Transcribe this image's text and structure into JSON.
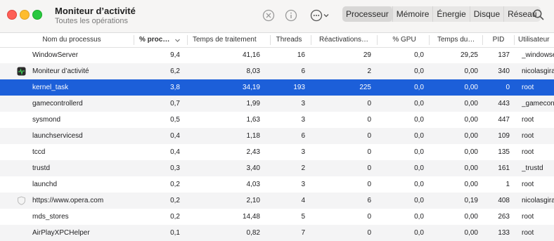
{
  "window": {
    "title": "Moniteur d’activité",
    "subtitle": "Toutes les opérations"
  },
  "toolbar": {
    "icons": [
      "stop-icon",
      "info-icon",
      "more-actions-icon",
      "search-icon"
    ],
    "tabs": [
      {
        "label": "Processeur",
        "active": true
      },
      {
        "label": "Mémoire",
        "active": false
      },
      {
        "label": "Énergie",
        "active": false
      },
      {
        "label": "Disque",
        "active": false
      },
      {
        "label": "Réseau",
        "active": false
      }
    ]
  },
  "table": {
    "columns": [
      "Nom du processus",
      "% proc…",
      "Temps de traitement",
      "Threads",
      "Réactivations…",
      "% GPU",
      "Temps du…",
      "PID",
      "Utilisateur"
    ],
    "sort_column": "% proc…",
    "rows": [
      {
        "name": "WindowServer",
        "cpu": "9,4",
        "time": "41,16",
        "threads": "16",
        "wakeups": "29",
        "gpu": "0,0",
        "gputime": "29,25",
        "pid": "137",
        "user": "_windowserver",
        "icon": ""
      },
      {
        "name": "Moniteur d’activité",
        "cpu": "6,2",
        "time": "8,03",
        "threads": "6",
        "wakeups": "2",
        "gpu": "0,0",
        "gputime": "0,00",
        "pid": "340",
        "user": "nicolasgirard",
        "icon": "activity-monitor-app-icon"
      },
      {
        "name": "kernel_task",
        "cpu": "3,8",
        "time": "34,19",
        "threads": "193",
        "wakeups": "225",
        "gpu": "0,0",
        "gputime": "0,00",
        "pid": "0",
        "user": "root",
        "icon": "",
        "selected": true
      },
      {
        "name": "gamecontrollerd",
        "cpu": "0,7",
        "time": "1,99",
        "threads": "3",
        "wakeups": "0",
        "gpu": "0,0",
        "gputime": "0,00",
        "pid": "443",
        "user": "_gamecontrollerd",
        "icon": ""
      },
      {
        "name": "sysmond",
        "cpu": "0,5",
        "time": "1,63",
        "threads": "3",
        "wakeups": "0",
        "gpu": "0,0",
        "gputime": "0,00",
        "pid": "447",
        "user": "root",
        "icon": ""
      },
      {
        "name": "launchservicesd",
        "cpu": "0,4",
        "time": "1,18",
        "threads": "6",
        "wakeups": "0",
        "gpu": "0,0",
        "gputime": "0,00",
        "pid": "109",
        "user": "root",
        "icon": ""
      },
      {
        "name": "tccd",
        "cpu": "0,4",
        "time": "2,43",
        "threads": "3",
        "wakeups": "0",
        "gpu": "0,0",
        "gputime": "0,00",
        "pid": "135",
        "user": "root",
        "icon": ""
      },
      {
        "name": "trustd",
        "cpu": "0,3",
        "time": "3,40",
        "threads": "2",
        "wakeups": "0",
        "gpu": "0,0",
        "gputime": "0,00",
        "pid": "161",
        "user": "_trustd",
        "icon": ""
      },
      {
        "name": "launchd",
        "cpu": "0,2",
        "time": "4,03",
        "threads": "3",
        "wakeups": "0",
        "gpu": "0,0",
        "gputime": "0,00",
        "pid": "1",
        "user": "root",
        "icon": ""
      },
      {
        "name": "https://www.opera.com",
        "cpu": "0,2",
        "time": "2,10",
        "threads": "4",
        "wakeups": "6",
        "gpu": "0,0",
        "gputime": "0,19",
        "pid": "408",
        "user": "nicolasgirard",
        "icon": "shield-icon"
      },
      {
        "name": "mds_stores",
        "cpu": "0,2",
        "time": "14,48",
        "threads": "5",
        "wakeups": "0",
        "gpu": "0,0",
        "gputime": "0,00",
        "pid": "263",
        "user": "root",
        "icon": ""
      },
      {
        "name": "AirPlayXPCHelper",
        "cpu": "0,1",
        "time": "0,82",
        "threads": "7",
        "wakeups": "0",
        "gpu": "0,0",
        "gputime": "0,00",
        "pid": "133",
        "user": "root",
        "icon": ""
      }
    ]
  },
  "colors": {
    "selection": "#1c5fd9",
    "stripe": "#f4f4f5",
    "close": "#fe5f57",
    "minimize": "#febc2e",
    "zoom": "#28c840"
  }
}
